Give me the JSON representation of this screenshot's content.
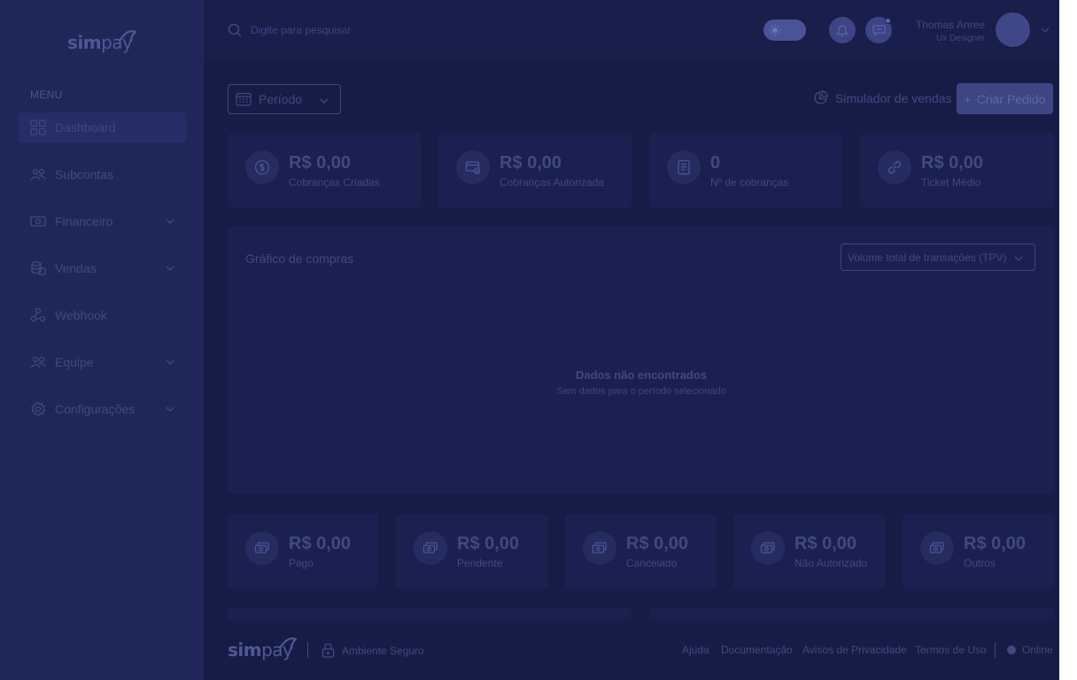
{
  "brand": {
    "name_bold": "sim",
    "name_light": "pay"
  },
  "sidebar": {
    "menu_title": "MENU",
    "items": [
      {
        "label": "Dashboard",
        "icon": "grid-icon"
      },
      {
        "label": "Subcontas",
        "icon": "users-icon"
      },
      {
        "label": "Financeiro",
        "icon": "money-icon"
      },
      {
        "label": "Vendas",
        "icon": "coins-icon"
      },
      {
        "label": "Webhook",
        "icon": "webhook-icon"
      },
      {
        "label": "Equipe",
        "icon": "team-icon"
      },
      {
        "label": "Configurações",
        "icon": "gear-icon"
      }
    ]
  },
  "topbar": {
    "search_placeholder": "Digite para pesquisar",
    "user_name": "Thomas Anree",
    "user_role": "Ux Designer"
  },
  "toolbar": {
    "period_label": "Período",
    "simulator_label": "Simulador de vendas",
    "create_label": "Criar Pedido"
  },
  "stats_top": [
    {
      "value": "R$ 0,00",
      "label": "Cobranças Criadas",
      "icon": "dollar-circle-icon"
    },
    {
      "value": "R$ 0,00",
      "label": "Cobranças Autorizada",
      "icon": "card-check-icon"
    },
    {
      "value": "0",
      "label": "Nº de cobranças",
      "icon": "document-icon"
    },
    {
      "value": "R$ 0,00",
      "label": "Ticket Médio",
      "icon": "link-icon"
    }
  ],
  "chart": {
    "title": "Gráfico de compras",
    "select_value": "Volume total de transações (TPV)",
    "empty_title": "Dados não encontrados",
    "empty_subtitle": "Sem dados para o período selecionado"
  },
  "stats_bottom": [
    {
      "value": "R$ 0,00",
      "label": "Pago"
    },
    {
      "value": "R$ 0,00",
      "label": "Pendente"
    },
    {
      "value": "R$ 0,00",
      "label": "Cancelado"
    },
    {
      "value": "R$ 0,00",
      "label": "Não Autorizado"
    },
    {
      "value": "R$ 0,00",
      "label": "Outros"
    }
  ],
  "footer": {
    "secure_label": "Ambiente Seguro",
    "links": [
      "Ajuda",
      "Documentação",
      "Avisos de Privacidade",
      "Termos de Uso"
    ],
    "status": "Online"
  }
}
